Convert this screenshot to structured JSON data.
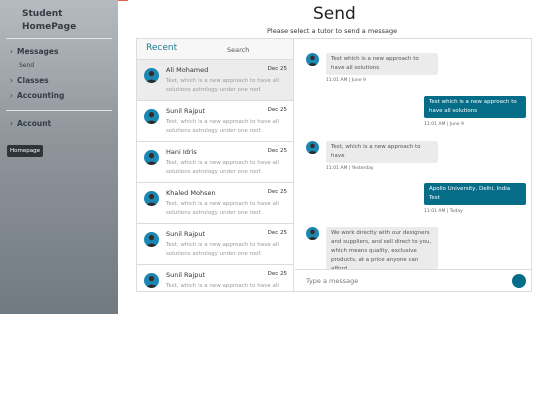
{
  "sidebar": {
    "title_line1": "Student",
    "title_line2": "HomePage",
    "items": [
      {
        "label": "Messages",
        "icon": "chevron-right-icon"
      },
      {
        "label": "Classes",
        "icon": "chevron-right-icon"
      },
      {
        "label": "Accounting",
        "icon": "chevron-right-icon"
      },
      {
        "label": "Account",
        "icon": "chevron-right-icon"
      }
    ],
    "submenu": {
      "send_label": "Send"
    },
    "tooltip": "Homepage",
    "chevron_glyph": "›"
  },
  "header": {
    "title": "Send",
    "subtitle": "Please select a tutor to send a message"
  },
  "list": {
    "recent_label": "Recent",
    "search_placeholder": "Search",
    "conversations": [
      {
        "name": "Ali Mohamed",
        "date": "Dec 25",
        "preview": "Test, which is a new approach to have all solutions astrology under one roof."
      },
      {
        "name": "Sunil Rajput",
        "date": "Dec 25",
        "preview": "Test, which is a new approach to have all solutions astrology under one roof."
      },
      {
        "name": "Hani Idris",
        "date": "Dec 25",
        "preview": "Test, which is a new approach to have all solutions astrology under one roof."
      },
      {
        "name": "Khaled Mohsen",
        "date": "Dec 25",
        "preview": "Test, which is a new approach to have all solutions astrology under one roof."
      },
      {
        "name": "Sunil Rajput",
        "date": "Dec 25",
        "preview": "Test, which is a new approach to have all solutions astrology under one roof."
      },
      {
        "name": "Sunil Rajput",
        "date": "Dec 25",
        "preview": "Test, which is a new approach to have all solutions astrology under one roof."
      }
    ]
  },
  "messages": [
    {
      "direction": "incoming",
      "text": "Test which is a new approach to have all solutions",
      "meta": "11:01 AM | June 9"
    },
    {
      "direction": "outgoing",
      "text": "Test which is a new approach to have all solutions",
      "meta": "11:01 AM | June 9"
    },
    {
      "direction": "incoming",
      "text": "Test, which is a new approach to have",
      "meta": "11:01 AM | Yesterday"
    },
    {
      "direction": "outgoing",
      "text": "Apollo University, Delhi, India Test",
      "meta": "11:01 AM | Today"
    },
    {
      "direction": "incoming",
      "text": "We work directly with our designers and suppliers, and sell direct to you, which means quality, exclusive products, at a price anyone can afford.",
      "meta": ""
    }
  ],
  "compose": {
    "placeholder": "Type a message",
    "send_icon": "send-icon"
  },
  "colors": {
    "accent": "#066d88",
    "recent_label": "#1a7a8f",
    "avatar_bg": "#1d87b3",
    "sidebar_top": "#b6bbbf",
    "sidebar_bottom": "#727a81"
  }
}
